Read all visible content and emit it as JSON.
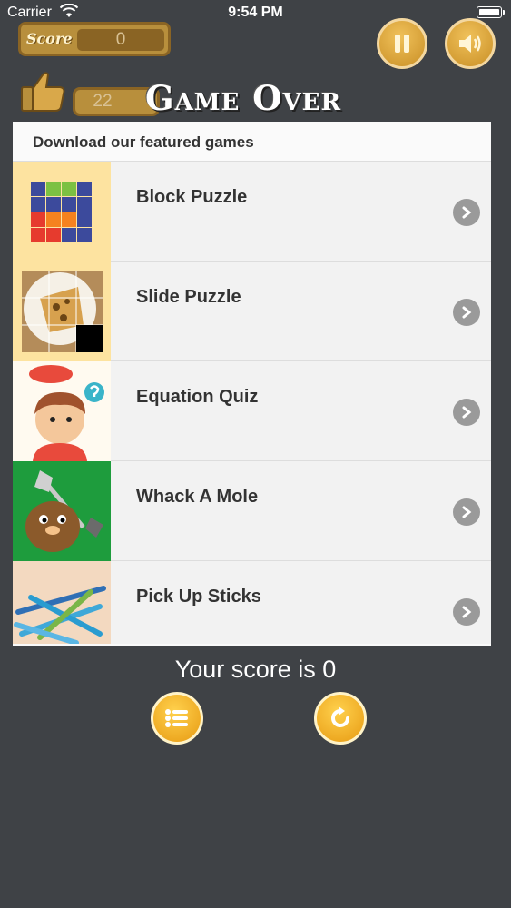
{
  "status_bar": {
    "carrier": "Carrier",
    "time": "9:54 PM"
  },
  "hud": {
    "score_label": "Score",
    "score_value": "0",
    "best_value": "22"
  },
  "title": "Game Over",
  "panel": {
    "header": "Download our featured games",
    "games": [
      {
        "name": "Block Puzzle"
      },
      {
        "name": "Slide Puzzle"
      },
      {
        "name": "Equation Quiz"
      },
      {
        "name": "Whack A Mole"
      },
      {
        "name": "Pick Up Sticks"
      }
    ]
  },
  "footer": {
    "score_text": "Your score is 0"
  },
  "colors": {
    "background": "#3f4246",
    "gold": "#e8a92a",
    "panel": "#fafafa"
  }
}
